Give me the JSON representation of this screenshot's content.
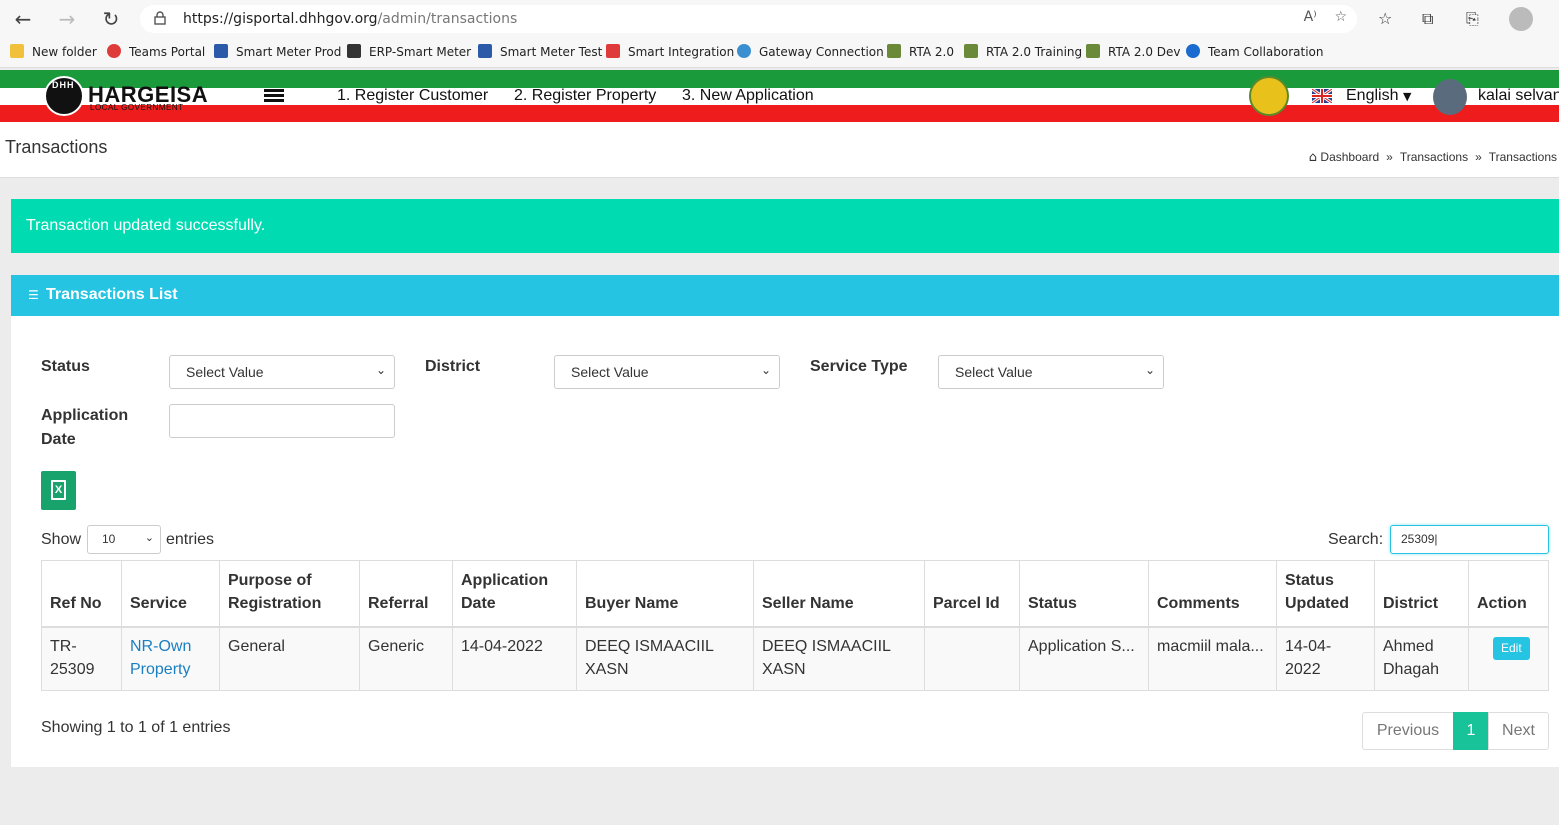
{
  "browser": {
    "url_host": "https://gisportal.dhhgov.org",
    "url_path": "/admin/transactions",
    "bookmarks": [
      "New folder",
      "Teams Portal",
      "Smart Meter Prod",
      "ERP-Smart Meter",
      "Smart Meter Test",
      "Smart Integration",
      "Gateway Connection",
      "RTA 2.0",
      "RTA 2.0 Training",
      "RTA 2.0 Dev",
      "Team Collaboration"
    ]
  },
  "header": {
    "logo_title": "HARGEISA",
    "logo_subtitle": "LOCAL GOVERNMENT",
    "logo_initials": "DHH",
    "nav": [
      "1. Register Customer",
      "2. Register Property",
      "3. New Application"
    ],
    "language": "English",
    "user": "kalai selvan"
  },
  "page": {
    "title": "Transactions",
    "breadcrumb": [
      "Dashboard",
      "Transactions",
      "Transactions"
    ],
    "alert": "Transaction updated successfully."
  },
  "card": {
    "title": "Transactions List",
    "filters": {
      "status_label": "Status",
      "district_label": "District",
      "service_type_label": "Service Type",
      "app_date_label_1": "Application",
      "app_date_label_2": "Date",
      "select_placeholder": "Select Value"
    },
    "show_label": "Show",
    "entries_label": "entries",
    "page_length": "10",
    "search_label": "Search:",
    "search_value": "25309"
  },
  "table": {
    "headers": [
      [
        "Ref No"
      ],
      [
        "Service"
      ],
      [
        "Purpose of",
        "Registration"
      ],
      [
        "Referral"
      ],
      [
        "Application",
        "Date"
      ],
      [
        "Buyer Name"
      ],
      [
        "Seller Name"
      ],
      [
        "Parcel Id"
      ],
      [
        "Status"
      ],
      [
        "Comments"
      ],
      [
        "Status",
        "Updated"
      ],
      [
        "District"
      ],
      [
        "Action"
      ]
    ],
    "rows": [
      {
        "ref_no": "TR-25309",
        "service": "NR-Own Property",
        "purpose": "General",
        "referral": "Generic",
        "app_date": "14-04-2022",
        "buyer": "DEEQ ISMAACIIL XASN",
        "seller": "DEEQ ISMAACIIL XASN",
        "parcel_id": "",
        "status": "Application S...",
        "comments": "macmiil mala...",
        "status_updated": "14-04-2022",
        "district": "Ahmed Dhagah",
        "action": "Edit"
      }
    ]
  },
  "footer": {
    "info": "Showing 1 to 1 of 1 entries",
    "prev": "Previous",
    "page": "1",
    "next": "Next"
  },
  "colors": {
    "accent": "#26c4e3",
    "success": "#00dbb2",
    "pager_active": "#18c39a",
    "excel": "#18a36d"
  }
}
